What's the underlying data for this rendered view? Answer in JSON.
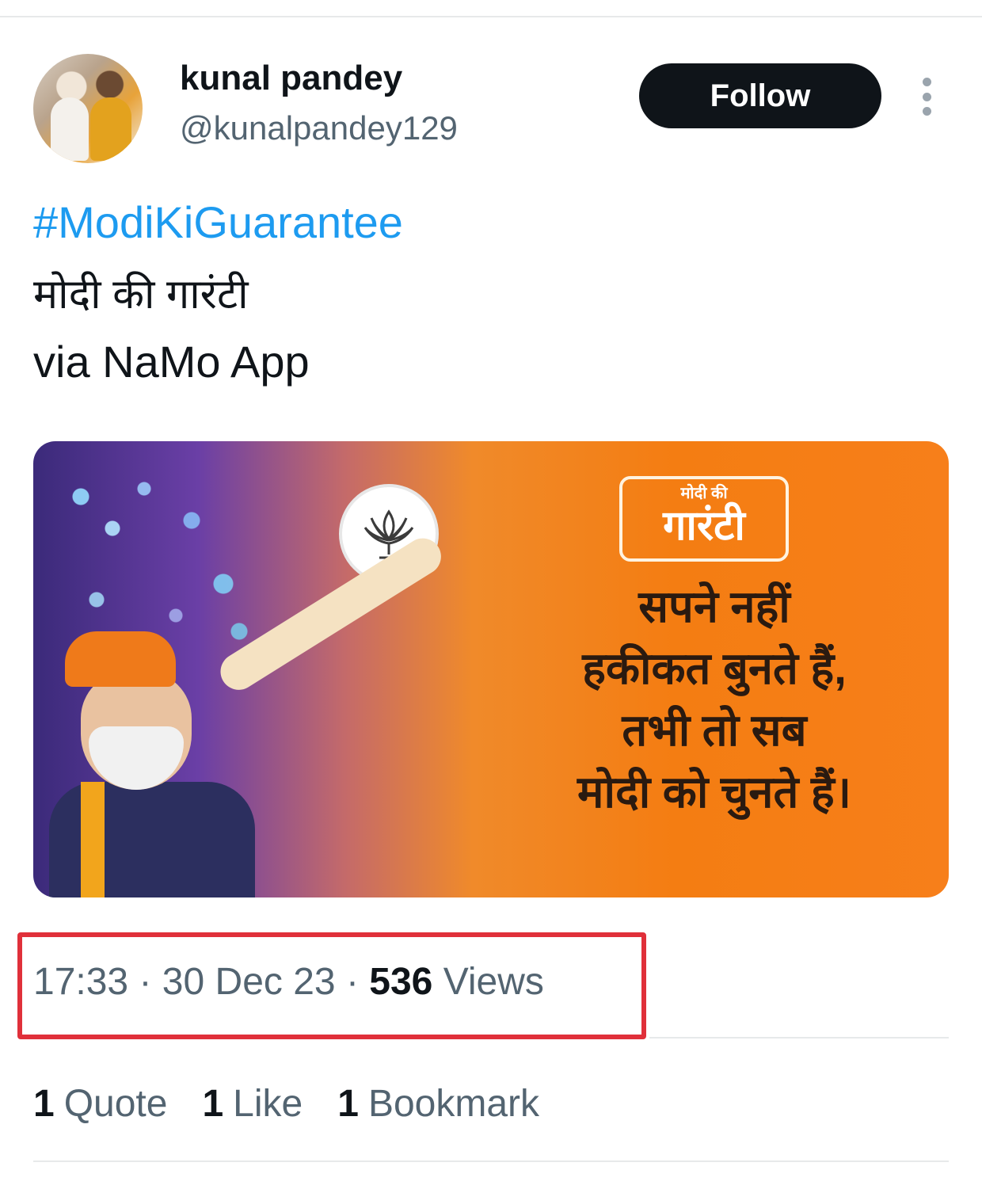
{
  "tweet": {
    "display_name": "kunal pandey",
    "handle": "@kunalpandey129",
    "follow_label": "Follow",
    "hashtag": "#ModiKiGuarantee",
    "text_hindi": "मोदी की गारंटी",
    "via": "via NaMo App",
    "media": {
      "brand_small": "मोदी की",
      "brand_big": "गारंटी",
      "slogan": [
        "सपने नहीं",
        "हकीकत बुनते हैं,",
        "तभी तो सब",
        "मोदी को चुनते हैं।"
      ]
    },
    "meta": {
      "time": "17:33",
      "date": "30 Dec 23",
      "views_count": "536",
      "views_label": "Views"
    },
    "stats": [
      {
        "count": "1",
        "label": "Quote"
      },
      {
        "count": "1",
        "label": "Like"
      },
      {
        "count": "1",
        "label": "Bookmark"
      }
    ]
  },
  "icons": [
    "more-vertical-icon",
    "bjp-lotus-logo"
  ],
  "colors": {
    "link": "#1d9bf0",
    "follow_bg": "#0f1419",
    "highlight_box": "#e0303a",
    "secondary_text": "#536471"
  }
}
